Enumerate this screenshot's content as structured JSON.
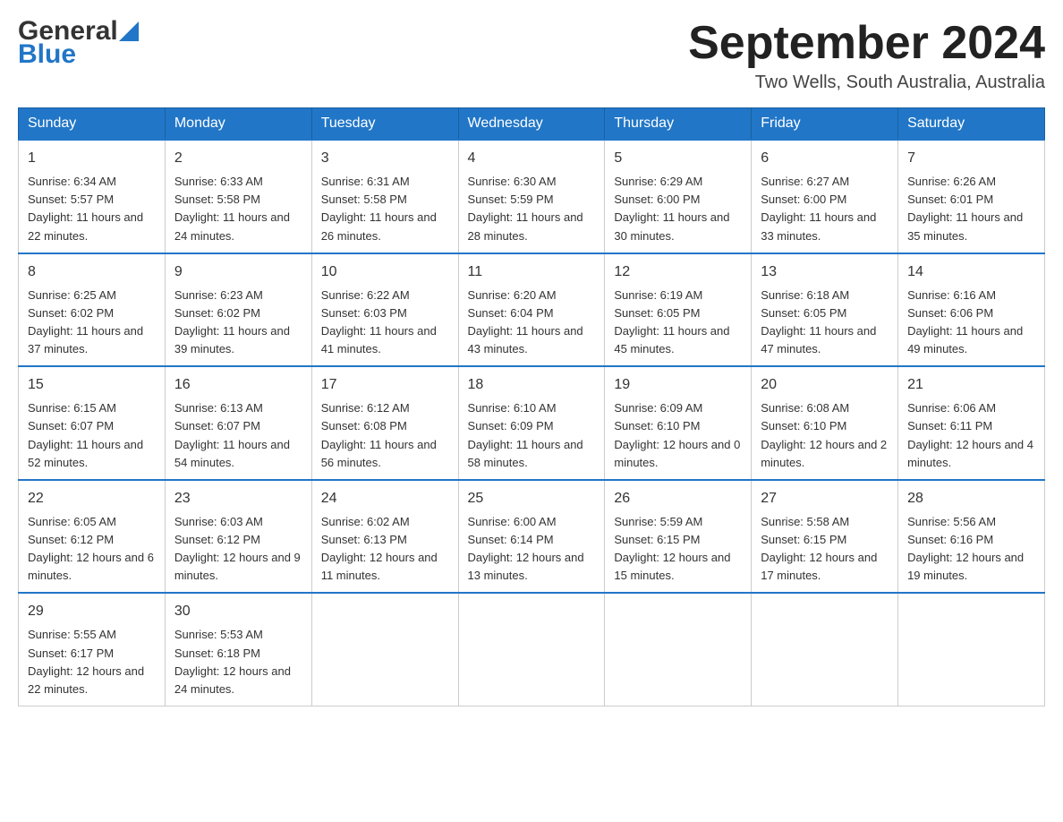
{
  "header": {
    "logo_text_general": "General",
    "logo_text_blue": "Blue",
    "month_year": "September 2024",
    "location": "Two Wells, South Australia, Australia"
  },
  "days_of_week": [
    "Sunday",
    "Monday",
    "Tuesday",
    "Wednesday",
    "Thursday",
    "Friday",
    "Saturday"
  ],
  "weeks": [
    [
      {
        "day": "1",
        "sunrise": "6:34 AM",
        "sunset": "5:57 PM",
        "daylight": "11 hours and 22 minutes."
      },
      {
        "day": "2",
        "sunrise": "6:33 AM",
        "sunset": "5:58 PM",
        "daylight": "11 hours and 24 minutes."
      },
      {
        "day": "3",
        "sunrise": "6:31 AM",
        "sunset": "5:58 PM",
        "daylight": "11 hours and 26 minutes."
      },
      {
        "day": "4",
        "sunrise": "6:30 AM",
        "sunset": "5:59 PM",
        "daylight": "11 hours and 28 minutes."
      },
      {
        "day": "5",
        "sunrise": "6:29 AM",
        "sunset": "6:00 PM",
        "daylight": "11 hours and 30 minutes."
      },
      {
        "day": "6",
        "sunrise": "6:27 AM",
        "sunset": "6:00 PM",
        "daylight": "11 hours and 33 minutes."
      },
      {
        "day": "7",
        "sunrise": "6:26 AM",
        "sunset": "6:01 PM",
        "daylight": "11 hours and 35 minutes."
      }
    ],
    [
      {
        "day": "8",
        "sunrise": "6:25 AM",
        "sunset": "6:02 PM",
        "daylight": "11 hours and 37 minutes."
      },
      {
        "day": "9",
        "sunrise": "6:23 AM",
        "sunset": "6:02 PM",
        "daylight": "11 hours and 39 minutes."
      },
      {
        "day": "10",
        "sunrise": "6:22 AM",
        "sunset": "6:03 PM",
        "daylight": "11 hours and 41 minutes."
      },
      {
        "day": "11",
        "sunrise": "6:20 AM",
        "sunset": "6:04 PM",
        "daylight": "11 hours and 43 minutes."
      },
      {
        "day": "12",
        "sunrise": "6:19 AM",
        "sunset": "6:05 PM",
        "daylight": "11 hours and 45 minutes."
      },
      {
        "day": "13",
        "sunrise": "6:18 AM",
        "sunset": "6:05 PM",
        "daylight": "11 hours and 47 minutes."
      },
      {
        "day": "14",
        "sunrise": "6:16 AM",
        "sunset": "6:06 PM",
        "daylight": "11 hours and 49 minutes."
      }
    ],
    [
      {
        "day": "15",
        "sunrise": "6:15 AM",
        "sunset": "6:07 PM",
        "daylight": "11 hours and 52 minutes."
      },
      {
        "day": "16",
        "sunrise": "6:13 AM",
        "sunset": "6:07 PM",
        "daylight": "11 hours and 54 minutes."
      },
      {
        "day": "17",
        "sunrise": "6:12 AM",
        "sunset": "6:08 PM",
        "daylight": "11 hours and 56 minutes."
      },
      {
        "day": "18",
        "sunrise": "6:10 AM",
        "sunset": "6:09 PM",
        "daylight": "11 hours and 58 minutes."
      },
      {
        "day": "19",
        "sunrise": "6:09 AM",
        "sunset": "6:10 PM",
        "daylight": "12 hours and 0 minutes."
      },
      {
        "day": "20",
        "sunrise": "6:08 AM",
        "sunset": "6:10 PM",
        "daylight": "12 hours and 2 minutes."
      },
      {
        "day": "21",
        "sunrise": "6:06 AM",
        "sunset": "6:11 PM",
        "daylight": "12 hours and 4 minutes."
      }
    ],
    [
      {
        "day": "22",
        "sunrise": "6:05 AM",
        "sunset": "6:12 PM",
        "daylight": "12 hours and 6 minutes."
      },
      {
        "day": "23",
        "sunrise": "6:03 AM",
        "sunset": "6:12 PM",
        "daylight": "12 hours and 9 minutes."
      },
      {
        "day": "24",
        "sunrise": "6:02 AM",
        "sunset": "6:13 PM",
        "daylight": "12 hours and 11 minutes."
      },
      {
        "day": "25",
        "sunrise": "6:00 AM",
        "sunset": "6:14 PM",
        "daylight": "12 hours and 13 minutes."
      },
      {
        "day": "26",
        "sunrise": "5:59 AM",
        "sunset": "6:15 PM",
        "daylight": "12 hours and 15 minutes."
      },
      {
        "day": "27",
        "sunrise": "5:58 AM",
        "sunset": "6:15 PM",
        "daylight": "12 hours and 17 minutes."
      },
      {
        "day": "28",
        "sunrise": "5:56 AM",
        "sunset": "6:16 PM",
        "daylight": "12 hours and 19 minutes."
      }
    ],
    [
      {
        "day": "29",
        "sunrise": "5:55 AM",
        "sunset": "6:17 PM",
        "daylight": "12 hours and 22 minutes."
      },
      {
        "day": "30",
        "sunrise": "5:53 AM",
        "sunset": "6:18 PM",
        "daylight": "12 hours and 24 minutes."
      },
      null,
      null,
      null,
      null,
      null
    ]
  ]
}
